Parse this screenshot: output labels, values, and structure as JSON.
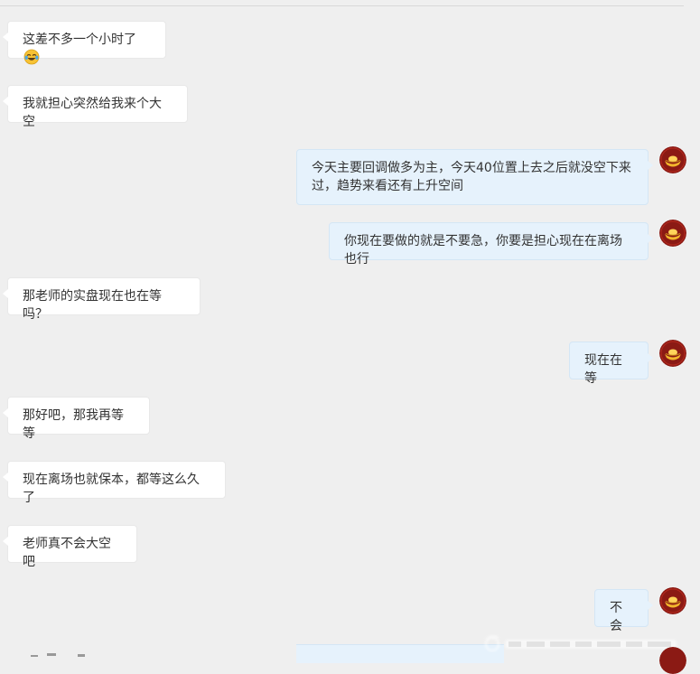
{
  "chat": {
    "messages": [
      {
        "side": "left",
        "text": "这差不多一个小时了",
        "emoji": "laughing-tears-emoji"
      },
      {
        "side": "left",
        "text": "我就担心突然给我来个大空"
      },
      {
        "side": "right",
        "text": "今天主要回调做多为主，今天40位置上去之后就没空下来过，趋势来看还有上升空间"
      },
      {
        "side": "right",
        "text": "你现在要做的就是不要急，你要是担心现在在离场也行"
      },
      {
        "side": "left",
        "text": "那老师的实盘现在也在等吗？"
      },
      {
        "side": "right",
        "text": "现在在等"
      },
      {
        "side": "left",
        "text": "那好吧，那我再等等"
      },
      {
        "side": "left",
        "text": "现在离场也就保本，都等这么久了"
      },
      {
        "side": "left",
        "text": "老师真不会大空吧"
      },
      {
        "side": "right",
        "text": "不会"
      }
    ]
  },
  "avatar": {
    "icon": "gold-ingot-avatar",
    "colors": {
      "background": "#8b1a14",
      "gold": "#f2b62c"
    }
  },
  "watermark": {
    "icon": "weibo-watermark-icon"
  },
  "colors": {
    "background": "#efefef",
    "left_bubble": "#ffffff",
    "right_bubble": "#e6f2fc",
    "text": "#333333"
  }
}
